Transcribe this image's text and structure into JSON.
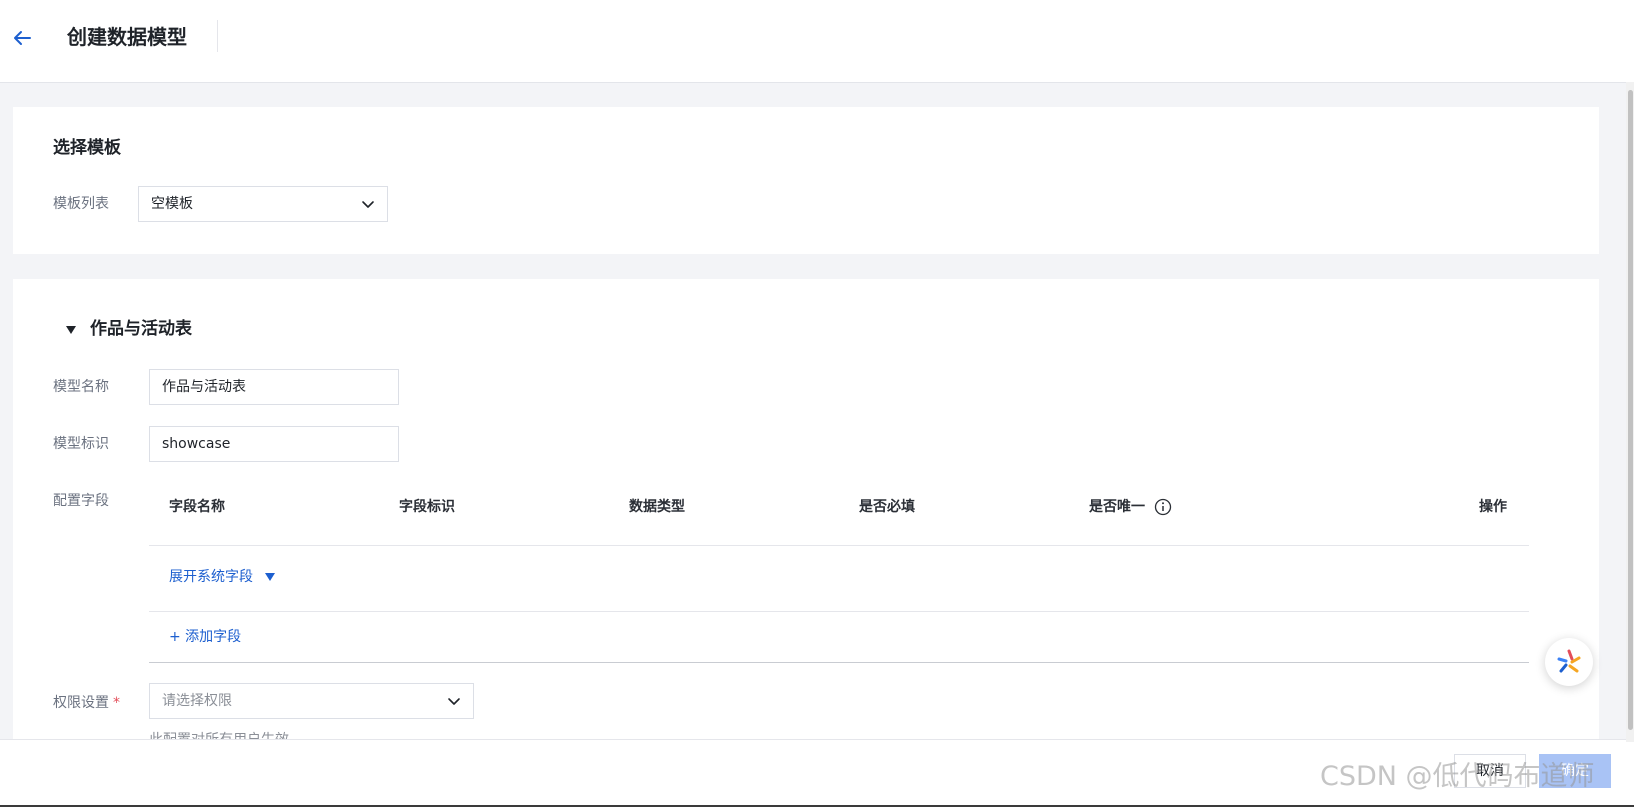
{
  "header": {
    "title": "创建数据模型"
  },
  "template_section": {
    "title": "选择模板",
    "list_label": "模板列表",
    "selected_template": "空模板"
  },
  "model_section": {
    "title": "作品与活动表",
    "name_label": "模型名称",
    "name_value": "作品与活动表",
    "id_label": "模型标识",
    "id_value": "showcase",
    "fields_label": "配置字段",
    "table": {
      "columns": [
        "字段名称",
        "字段标识",
        "数据类型",
        "是否必填",
        "是否唯一",
        "操作"
      ],
      "expand_system_fields": "展开系统字段",
      "add_field": "+ 添加字段"
    },
    "permission_label": "权限设置",
    "permission_required": "*",
    "permission_placeholder": "请选择权限",
    "permission_hint": "此配置对所有用户生效"
  },
  "footer": {
    "cancel_label": "取消",
    "confirm_label": "确定"
  },
  "watermark": "CSDN @低代码布道师",
  "colors": {
    "primary_link": "#1d5fcf",
    "required": "#e34d59",
    "confirm_disabled": "#a9c3f5"
  }
}
